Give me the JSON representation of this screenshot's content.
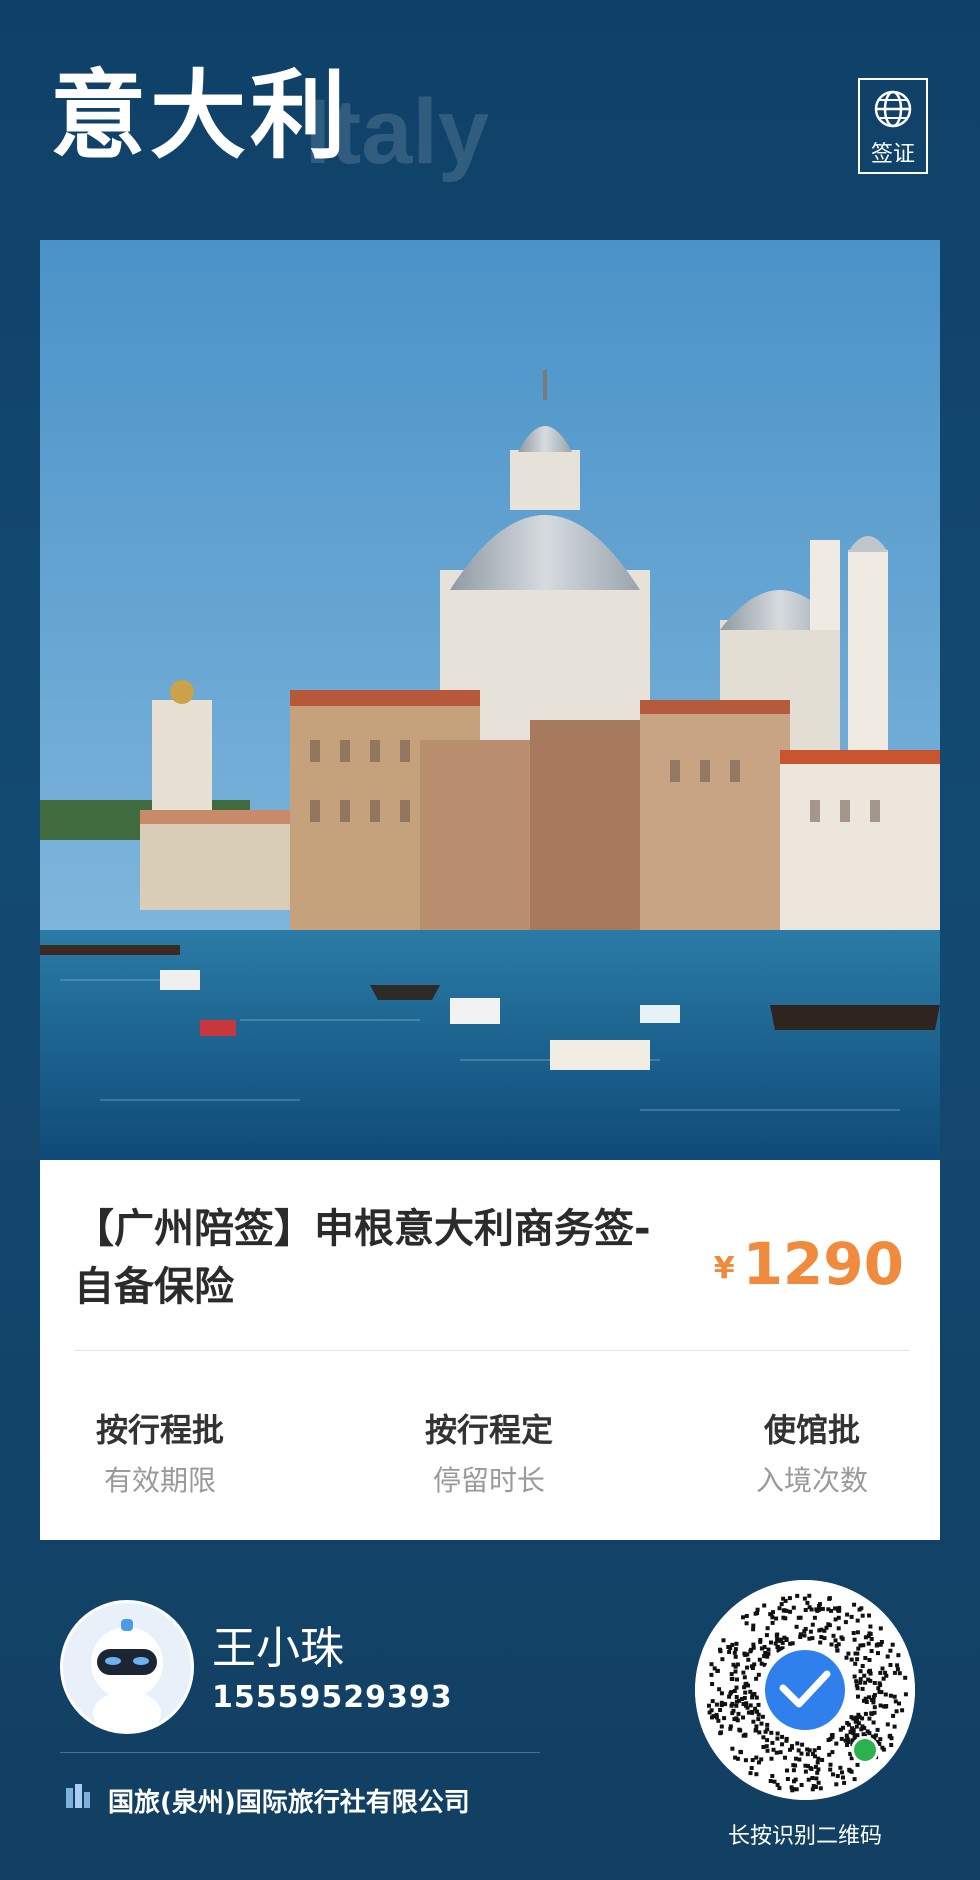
{
  "header": {
    "country_cn": "意大利",
    "country_en": "Italy",
    "visa_badge_label": "签证",
    "visa_badge_icon": "globe-icon"
  },
  "product": {
    "title_line1": "【广州陪签】申根意大利商务签-",
    "title_line2": "自备保险",
    "price_symbol": "¥",
    "price": "1290",
    "price_color": "#f08a3c",
    "specs": [
      {
        "value": "按行程批",
        "label": "有效期限"
      },
      {
        "value": "按行程定",
        "label": "停留时长"
      },
      {
        "value": "使馆批",
        "label": "入境次数"
      }
    ]
  },
  "agent": {
    "name": "王小珠",
    "phone": "15559529393",
    "company": "国旅(泉州)国际旅行社有限公司",
    "qr_caption": "长按识别二维码"
  },
  "colors": {
    "background": "#134a72",
    "accent": "#f08a3c"
  }
}
